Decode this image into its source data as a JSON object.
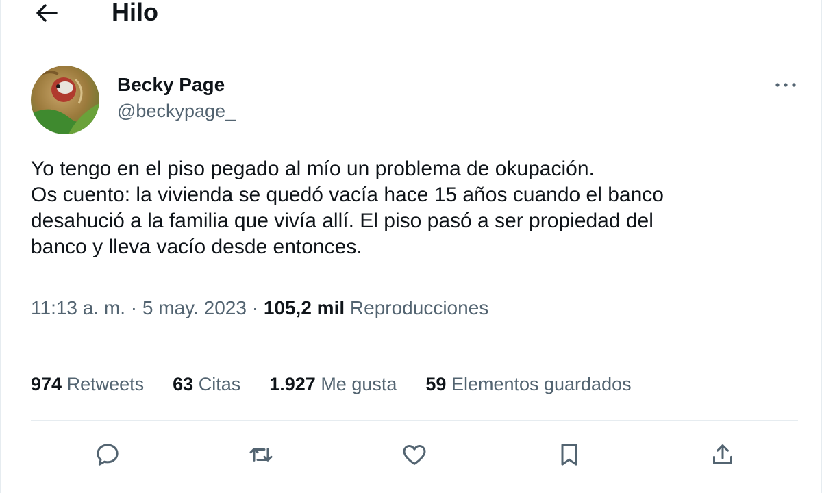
{
  "header": {
    "title": "Hilo",
    "back_icon": "arrow-left-icon"
  },
  "author": {
    "display_name": "Becky Page",
    "handle": "@beckypage_",
    "more_icon": "more-horizontal-icon"
  },
  "tweet": {
    "lines": [
      "Yo tengo en el piso pegado al mío un problema de okupación.",
      "Os cuento: la vivienda se quedó vacía hace 15 años cuando el banco",
      "desahució a la familia que vivía allí. El piso pasó a ser propiedad del",
      "banco y lleva vacío desde entonces."
    ],
    "time": "11:13 a. m.",
    "date": "5 may. 2023",
    "separator": "·",
    "views_count": "105,2 mil",
    "views_label": "Reproducciones"
  },
  "stats": [
    {
      "count": "974",
      "label": "Retweets"
    },
    {
      "count": "63",
      "label": "Citas"
    },
    {
      "count": "1.927",
      "label": "Me gusta"
    },
    {
      "count": "59",
      "label": "Elementos guardados"
    }
  ],
  "actions": [
    {
      "name": "reply",
      "icon": "reply-icon"
    },
    {
      "name": "retweet",
      "icon": "retweet-icon"
    },
    {
      "name": "like",
      "icon": "heart-icon"
    },
    {
      "name": "bookmark",
      "icon": "bookmark-icon"
    },
    {
      "name": "share",
      "icon": "share-icon"
    }
  ],
  "colors": {
    "text": "#0f1419",
    "secondary": "#536471",
    "divider": "#e6ecf0"
  }
}
